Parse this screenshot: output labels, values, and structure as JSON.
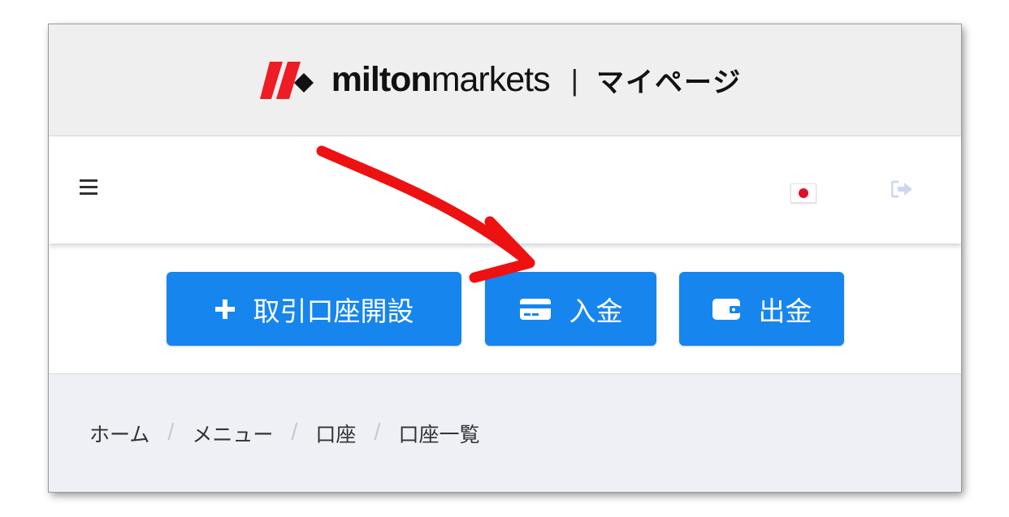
{
  "brand": {
    "name_bold": "milton",
    "name_light": "markets",
    "separator": "|",
    "page_title": "マイページ",
    "logo_color": "#ee1c25"
  },
  "nav": {
    "menu_icon": "hamburger-icon",
    "language_flag": "japan-flag-icon",
    "logout_icon": "logout-icon"
  },
  "actions": {
    "open_account_label": "取引口座開設",
    "deposit_label": "入金",
    "withdraw_label": "出金",
    "button_color": "#1685ee"
  },
  "breadcrumb": {
    "items": [
      "ホーム",
      "メニュー",
      "口座",
      "口座一覧"
    ],
    "separator": "/"
  },
  "annotation": {
    "color": "#ee1111"
  }
}
